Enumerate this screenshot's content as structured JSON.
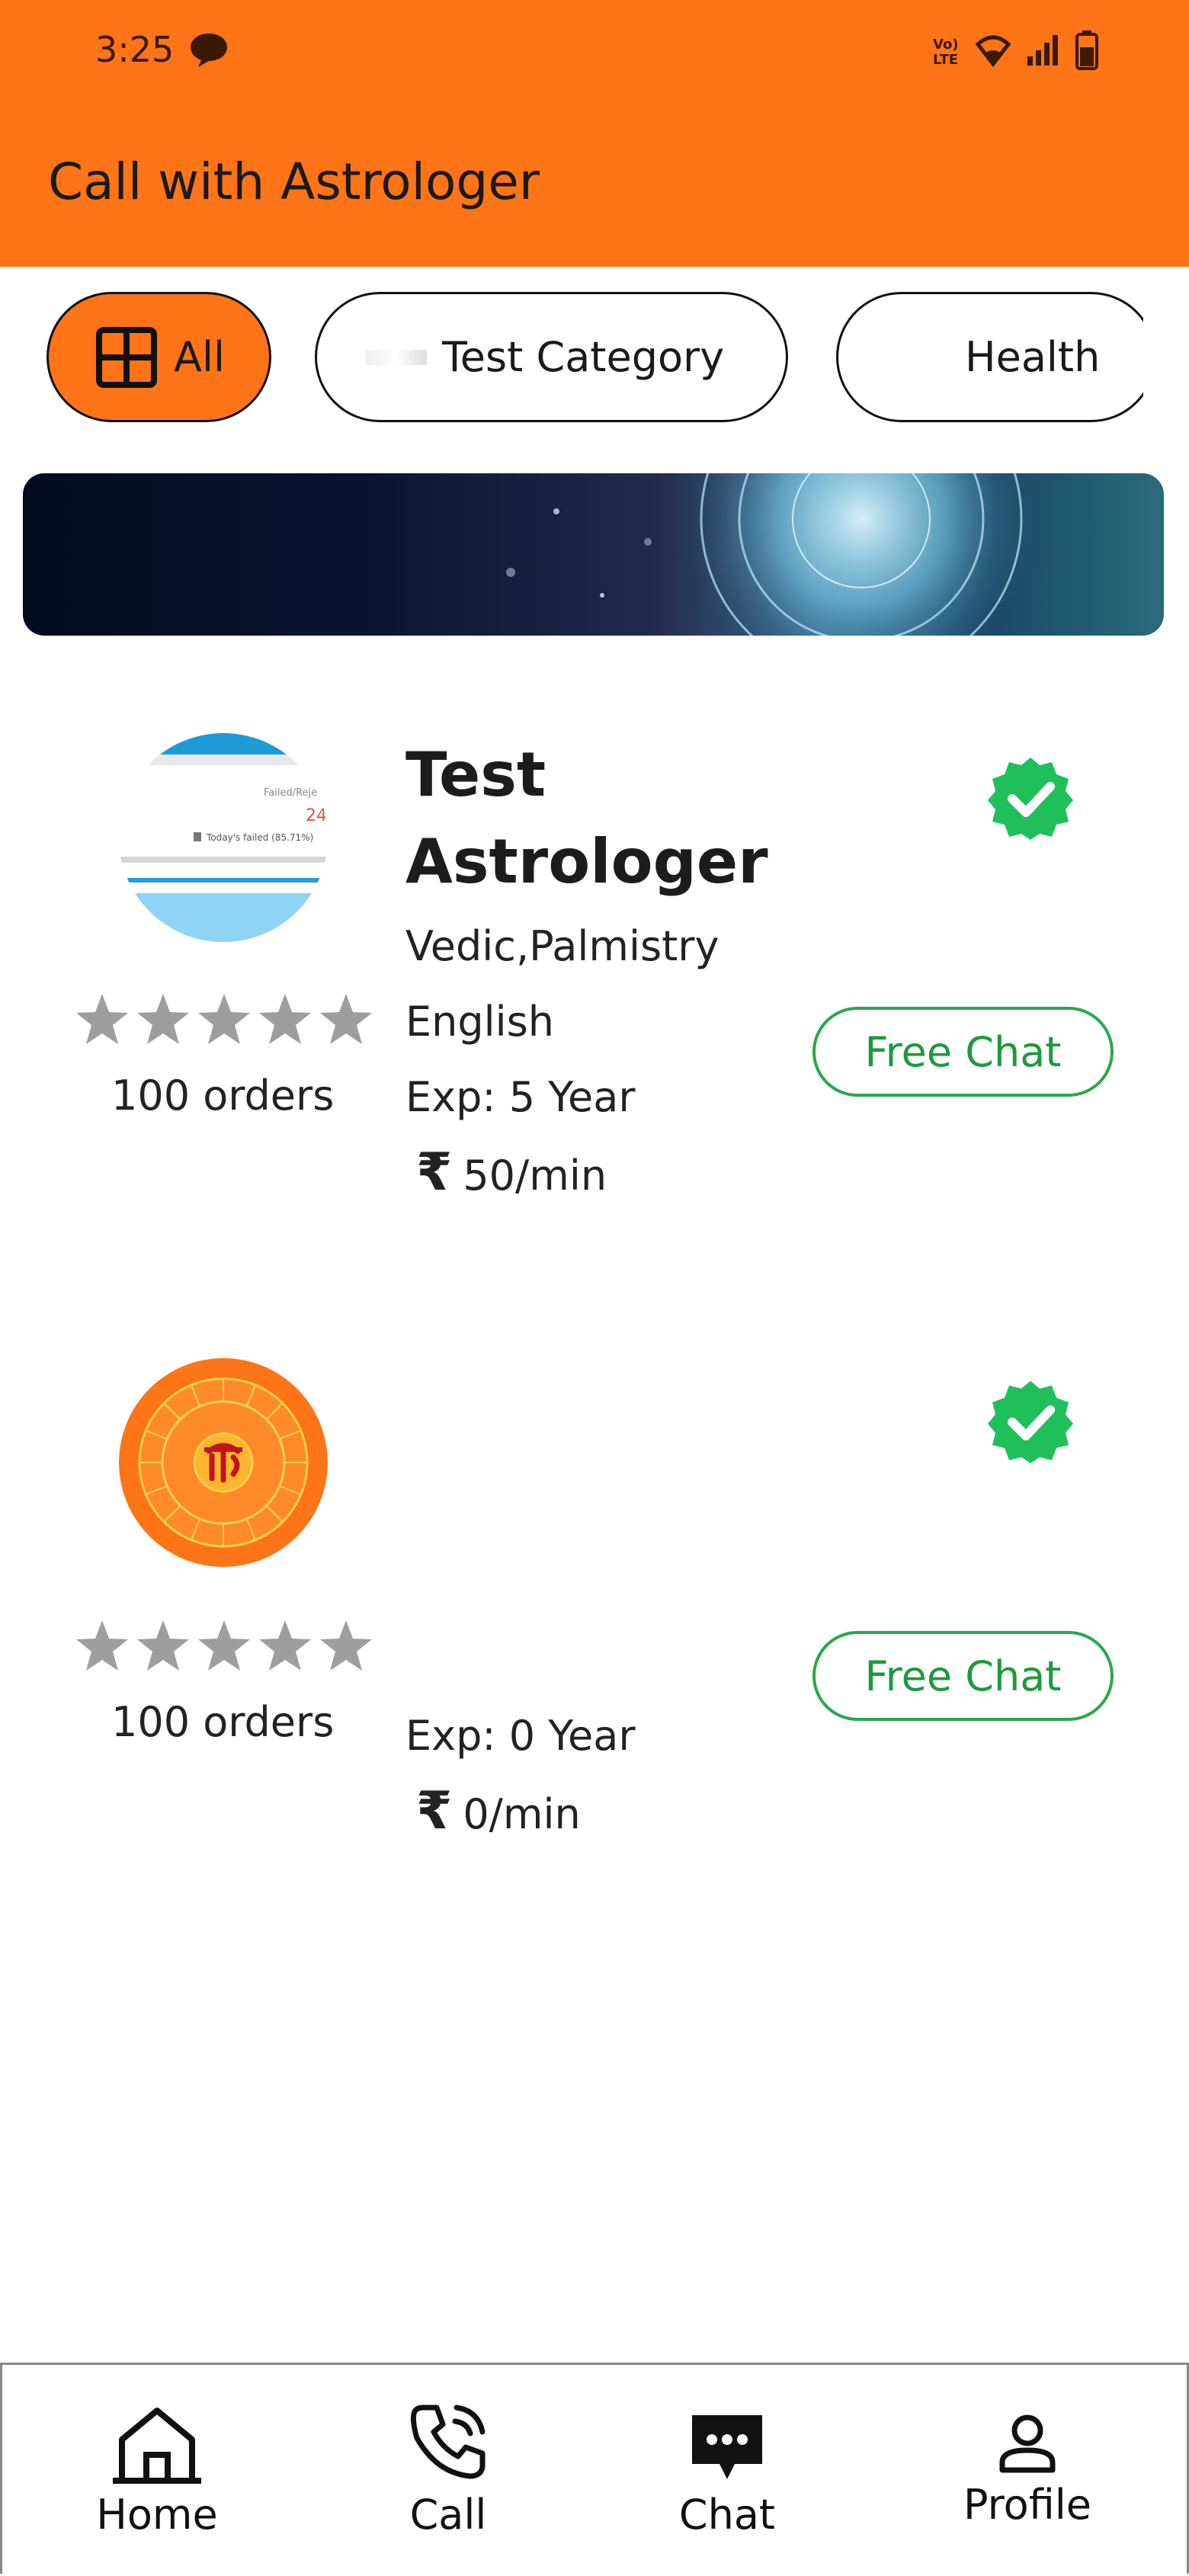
{
  "status_bar": {
    "time": "3:25",
    "icons": [
      "message-icon",
      "volte-icon",
      "wifi-icon",
      "signal-icon",
      "battery-icon"
    ]
  },
  "app_bar": {
    "title": "Call with Astrologer"
  },
  "categories": [
    {
      "label": "All",
      "icon": "grid-icon",
      "selected": true
    },
    {
      "label": "Test Category",
      "selected": false
    },
    {
      "label": "Health",
      "selected": false
    }
  ],
  "astrologers": [
    {
      "name": "Test Astrologer",
      "skills": "Vedic,Palmistry",
      "language": "English",
      "experience": "Exp: 5 Year",
      "price": "50/min",
      "orders": "100 orders",
      "rating": 0,
      "verified": true,
      "action": "Free Chat"
    },
    {
      "name": "",
      "skills": "",
      "language": "",
      "experience": "Exp: 0 Year",
      "price": "0/min",
      "orders": "100 orders",
      "rating": 0,
      "verified": true,
      "action": "Free Chat"
    }
  ],
  "currency_symbol": "₹",
  "bottom_nav": [
    {
      "label": "Home",
      "icon": "home-icon"
    },
    {
      "label": "Call",
      "icon": "phone-icon"
    },
    {
      "label": "Chat",
      "icon": "chat-icon"
    },
    {
      "label": "Profile",
      "icon": "profile-icon"
    }
  ],
  "colors": {
    "accent": "#ff7417",
    "verified": "#1fc05a",
    "free_chat": "#2aa84a",
    "star": "#9e9e9e"
  }
}
